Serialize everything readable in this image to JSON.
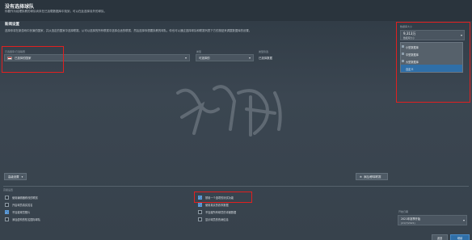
{
  "header": {
    "title": "没有选择球队",
    "subtitle": "你要作为经理执教的球队尚未在已加载数据库中找到，可以在此选择另外的球队。"
  },
  "section": {
    "title": "新闻设置",
    "description": "选择你将在新游戏中扮演的国家，并从选定的国家中选择联赛。从可以选择的所有联赛中选择合适的联赛，然后选择你想要执教的球队。你也可以通过选择球队和联赛列表下方的按钮来调整数据库的设置。"
  },
  "filters": {
    "nation_label": "已选国家/已选联赛",
    "nation_value": "已选择的国家",
    "league_label": "类型",
    "league_value": "可选择的",
    "type_label": "类型筛选",
    "type_value": "已选择数据"
  },
  "budget": {
    "label": "数据库大小",
    "value": "9,313万",
    "sub": "数据库大小",
    "options": [
      {
        "label": "小型数据库",
        "selected": false
      },
      {
        "label": "中型数据库",
        "selected": false
      },
      {
        "label": "大型数据库",
        "selected": false
      },
      {
        "label": "自定义",
        "selected": true
      }
    ]
  },
  "buttons": {
    "advanced": "高级设置",
    "add_remove": "添加/移除联赛",
    "back": "返回",
    "continue": "继续"
  },
  "options_header": "高级设置",
  "options": {
    "col1": [
      {
        "label": "使用编辑器修改的联赛",
        "checked": false
      },
      {
        "label": "开启球员真实姓名",
        "checked": false
      },
      {
        "label": "不加载球员照片",
        "checked": true
      },
      {
        "label": "添加虚构的知名国际球队",
        "checked": false
      }
    ],
    "col2": [
      {
        "label": "禁用一个选项的测试功能",
        "checked": true
      },
      {
        "label": "使用真实的赛事数据",
        "checked": true
      },
      {
        "label": "不加载所有球员的详细数据",
        "checked": false
      },
      {
        "label": "显示球员的伤病信息",
        "checked": false
      }
    ]
  },
  "footer": {
    "label": "开始日期",
    "value": "2021年赛季开始",
    "sub": "(21/7/2021)"
  },
  "watermark": "游侠网"
}
